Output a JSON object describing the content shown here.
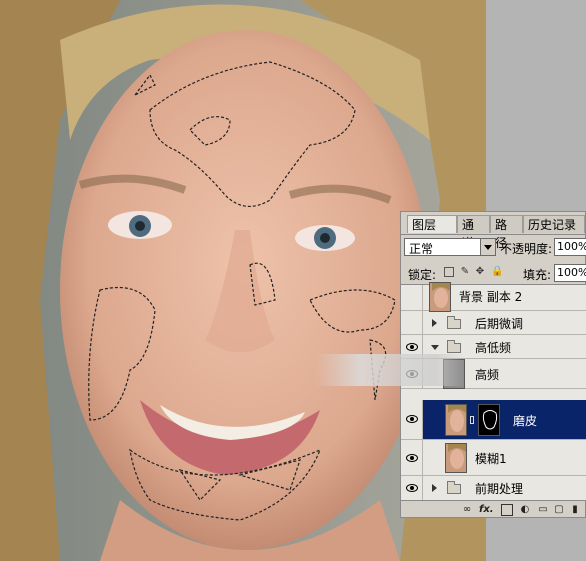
{
  "colors": {
    "panel_bg": "#d4d0c8",
    "selection_blue": "#0a246a",
    "skin": "#e6b59c"
  },
  "panel": {
    "tabs": [
      {
        "label": "图层",
        "close": "×"
      },
      {
        "label": "通道"
      },
      {
        "label": "路径"
      },
      {
        "label": "历史记录"
      }
    ],
    "blend_mode": "正常",
    "opacity_label": "不透明度:",
    "opacity_value": "100%",
    "lock_label": "锁定:",
    "fill_label": "填充:",
    "fill_value": "100%",
    "lock_icons": [
      "lock-transparent-icon",
      "lock-paint-icon",
      "lock-move-icon",
      "lock-all-icon"
    ],
    "bottom_icons": [
      "link-icon",
      "fx-icon",
      "add-mask-icon",
      "adjustment-icon",
      "new-group-icon",
      "new-layer-icon",
      "trash-icon"
    ],
    "fx_label": "fx."
  },
  "layers": [
    {
      "name": "背景 副本 2",
      "visible": false,
      "type": "layer"
    },
    {
      "name": "后期微调",
      "visible": false,
      "type": "group",
      "expanded": false
    },
    {
      "name": "高低频",
      "visible": true,
      "type": "group",
      "expanded": true
    },
    {
      "name": "高频",
      "visible": true,
      "type": "layer",
      "partial": true
    },
    {
      "name": "磨皮",
      "visible": true,
      "type": "layer-mask",
      "selected": true
    },
    {
      "name": "模糊1",
      "visible": true,
      "type": "layer"
    },
    {
      "name": "前期处理",
      "visible": true,
      "type": "group",
      "expanded": false
    }
  ]
}
